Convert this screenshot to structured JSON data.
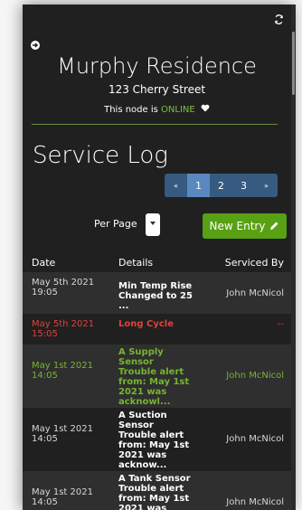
{
  "header": {
    "title": "Murphy Residence",
    "address": "123 Cherry Street",
    "status_prefix": "This node is ",
    "status_value": "ONLINE",
    "refresh_icon": "refresh-icon",
    "back_icon": "arrow-circle-right-icon"
  },
  "main": {
    "heading": "Service Log",
    "pagination": [
      "«",
      "1",
      "2",
      "3",
      "»"
    ],
    "per_page_label": "Per Page",
    "new_entry_label": "New Entry"
  },
  "table": {
    "columns": [
      "Date",
      "Details",
      "Serviced By"
    ],
    "rows": [
      {
        "date": "May 5th 2021\n19:05",
        "details": "Min Temp Rise\nChanged to 25 ...",
        "by": "John McNicol",
        "status": "normal"
      },
      {
        "date": "May 5th 2021\n15:05",
        "details": "Long Cycle",
        "by": "--",
        "status": "alert"
      },
      {
        "date": "May 1st 2021\n14:05",
        "details": "A Supply Sensor\nTrouble alert\nfrom: May 1st\n2021 was\nacknowl...",
        "by": "John McNicol",
        "status": "acknowledged"
      },
      {
        "date": "May 1st 2021\n14:05",
        "details": "A Suction Sensor\nTrouble alert\nfrom: May 1st\n2021 was\nacknow...",
        "by": "John McNicol",
        "status": "normal"
      },
      {
        "date": "May 1st 2021\n14:05",
        "details": "A Tank Sensor\nTrouble alert\nfrom: May 1st\n2021 was",
        "by": "John McNicol",
        "status": "normal"
      }
    ]
  },
  "colors": {
    "background": "#202020",
    "online": "#7ac142",
    "alert": "#e0413b",
    "acknowledged": "#76b530",
    "button": "#58a014",
    "pagination": "#365a80"
  }
}
